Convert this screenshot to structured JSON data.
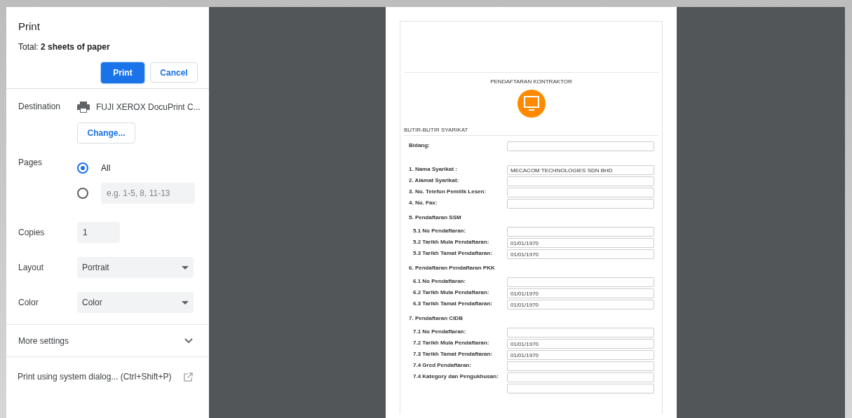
{
  "panel": {
    "title": "Print",
    "total": "Total: **2 sheets of paper**",
    "buttons": [
      {
        "kind": "primary",
        "label": "Print"
      },
      {
        "kind": "secondary",
        "label": "Cancel"
      }
    ],
    "destination": {
      "label": "Destination",
      "printer": "FUJI XEROX DocuPrint C...",
      "button": "Change..."
    },
    "pages": {
      "label": "Pages",
      "options": [
        {
          "kind": "all",
          "label": "All",
          "selected": true
        },
        {
          "kind": "custom",
          "placeholder": "e.g. 1-5, 8, 11-13",
          "selected": false
        }
      ]
    },
    "copies": {
      "label": "Copies",
      "value": "1"
    },
    "layout": {
      "label": "Layout",
      "value": "Portrait"
    },
    "color": {
      "label": "Color",
      "value": "Color"
    },
    "more_settings": {
      "label": "More settings",
      "expanded": false
    },
    "system_dialog": "Print using system dialog... (Ctrl+Shift+P)"
  },
  "preview": {
    "title": "PENDAFTARAN KONTRAKTOR",
    "section": "BUTIR-BUTIR SYARIKAT",
    "items": [
      {
        "kind": "field",
        "label": "Bidang:"
      },
      {
        "kind": "field",
        "label": "1. Nama Syarikat :",
        "value": "MECACOM TECHNOLOGIES SDN BHD"
      },
      {
        "kind": "field",
        "label": "2. Alamat Syarikat:"
      },
      {
        "kind": "field",
        "label": "3. No. Telefon Pemilik Lesen:"
      },
      {
        "kind": "field",
        "label": "4. No. Fax:"
      },
      {
        "kind": "group",
        "label": "5. Pendaftaran SSM",
        "children": [
          {
            "kind": "field",
            "label": "5.1 No Pendaftaran:"
          },
          {
            "kind": "field",
            "label": "5.2 Tarikh Mula Pendaftaran:",
            "value": "01/01/1970"
          },
          {
            "kind": "field",
            "label": "5.3 Tarikh Tamat Pendaftaran:",
            "value": "01/01/1970"
          }
        ]
      },
      {
        "kind": "group",
        "label": "6. Pendaftaran Pendaftaran PKK",
        "children": [
          {
            "kind": "field",
            "label": "6.1 No Pendaftaran:"
          },
          {
            "kind": "field",
            "label": "6.2 Tarikh Mula Pendaftaran:",
            "value": "01/01/1970"
          },
          {
            "kind": "field",
            "label": "6.3 Tarikh Tamat Pendaftaran:",
            "value": "01/01/1970"
          }
        ]
      },
      {
        "kind": "group",
        "label": "7. Pendaftaran CIDB",
        "children": [
          {
            "kind": "field",
            "label": "7.1 No Pendaftaran:"
          },
          {
            "kind": "field",
            "label": "7.2 Tarikh Mula Pendaftaran:",
            "value": "01/01/1970"
          },
          {
            "kind": "field",
            "label": "7.3 Tarikh Tamat Pendaftaran:",
            "value": "01/01/1970"
          },
          {
            "kind": "field",
            "label": "7.4 Gred Pendaftaran:"
          },
          {
            "kind": "field",
            "label": "7.4 Kategory dan Pengukhusan:"
          },
          {
            "kind": "blank"
          }
        ]
      }
    ]
  }
}
